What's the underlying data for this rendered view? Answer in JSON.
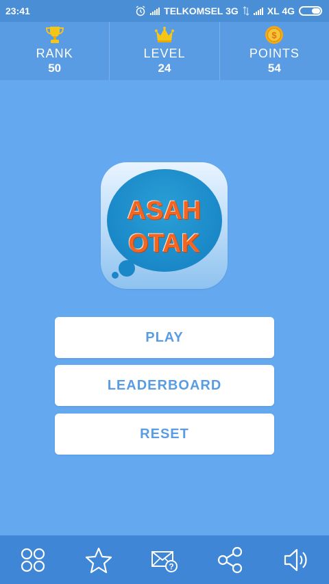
{
  "status_bar": {
    "time": "23:41",
    "carrier1": "TELKOMSEL 3G",
    "carrier2": "XL 4G",
    "icons": [
      "alarm-icon",
      "signal-icon",
      "data-arrows-icon",
      "signal-icon",
      "battery-icon"
    ]
  },
  "stats": [
    {
      "label": "RANK",
      "value": "50",
      "icon": "trophy-icon"
    },
    {
      "label": "LEVEL",
      "value": "24",
      "icon": "crown-icon"
    },
    {
      "label": "POINTS",
      "value": "54",
      "icon": "coin-icon"
    }
  ],
  "logo": {
    "line1": "ASAH",
    "line2": "OTAK"
  },
  "menu": {
    "play": "PLAY",
    "leaderboard": "LEADERBOARD",
    "reset": "RESET"
  },
  "bottom_nav": [
    "more-apps-icon",
    "star-icon",
    "mail-help-icon",
    "share-icon",
    "sound-icon"
  ],
  "colors": {
    "background": "#64a8f0",
    "stats_bar": "#5a9ce3",
    "bottom_nav": "#3f86d6",
    "logo_text": "#f26522",
    "button_text": "#5a9ce3",
    "trophy": "#f5c518",
    "coin": "#f2a818"
  }
}
